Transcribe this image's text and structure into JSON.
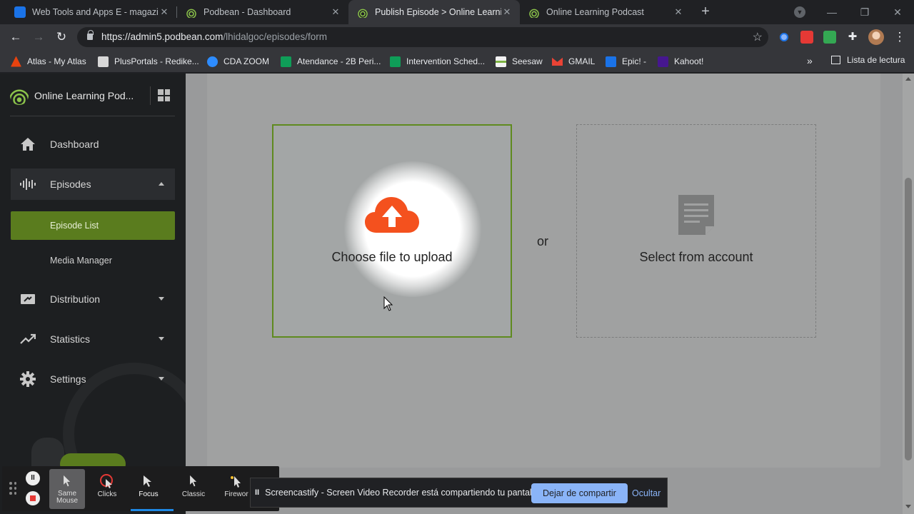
{
  "browser": {
    "tabs": [
      {
        "title": "Web Tools and Apps E - magazine",
        "icon": "webtools-icon",
        "active": false
      },
      {
        "title": "Podbean - Dashboard",
        "icon": "podbean-icon",
        "active": false
      },
      {
        "title": "Publish Episode > Online Learning",
        "icon": "podbean-icon",
        "active": true
      },
      {
        "title": "Online Learning Podcast",
        "icon": "podbean-icon",
        "active": false
      }
    ],
    "url_domain": "https://admin5.podbean.com",
    "url_path": "/lhidalgoc/episodes/form",
    "bookmarks": [
      {
        "label": "Atlas - My Atlas",
        "color": "#e8430f"
      },
      {
        "label": "PlusPortals - Redike...",
        "color": "#d7d7d7"
      },
      {
        "label": "CDA ZOOM",
        "color": "#2d8cff"
      },
      {
        "label": "Atendance - 2B Peri...",
        "color": "#0f9d58"
      },
      {
        "label": "Intervention Sched...",
        "color": "#0f9d58"
      },
      {
        "label": "Seesaw",
        "color": "#f2f2f2"
      },
      {
        "label": "GMAIL",
        "color": "#ea4335"
      },
      {
        "label": "Epic! -",
        "color": "#1a73e8"
      },
      {
        "label": "Kahoot!",
        "color": "#46178f"
      }
    ],
    "reading_list": "Lista de lectura"
  },
  "sidebar": {
    "brand": "Online Learning Pod...",
    "items": [
      {
        "label": "Dashboard",
        "icon": "home-icon"
      },
      {
        "label": "Episodes",
        "icon": "waveform-icon"
      },
      {
        "label": "Distribution",
        "icon": "distribution-icon"
      },
      {
        "label": "Statistics",
        "icon": "statistics-icon"
      },
      {
        "label": "Settings",
        "icon": "gear-icon"
      }
    ],
    "sub_items": [
      {
        "label": "Episode List",
        "active": true
      },
      {
        "label": "Media Manager",
        "active": false
      }
    ]
  },
  "main": {
    "upload_label": "Choose file to upload",
    "or_label": "or",
    "select_label": "Select from account"
  },
  "screencastify": {
    "tools": [
      {
        "label": "Same Mouse",
        "state": "selected"
      },
      {
        "label": "Clicks",
        "state": ""
      },
      {
        "label": "Focus",
        "state": "focus"
      },
      {
        "label": "Classic",
        "state": ""
      },
      {
        "label": "Firewor",
        "state": ""
      }
    ],
    "notice": "Screencastify - Screen Video Recorder está compartiendo tu pantalla.",
    "stop_share": "Dejar de compartir",
    "hide": "Ocultar"
  },
  "colors": {
    "accent_green": "#5a7c1e",
    "upload_red": "#f4511e",
    "chrome_blue": "#8ab4f8"
  }
}
